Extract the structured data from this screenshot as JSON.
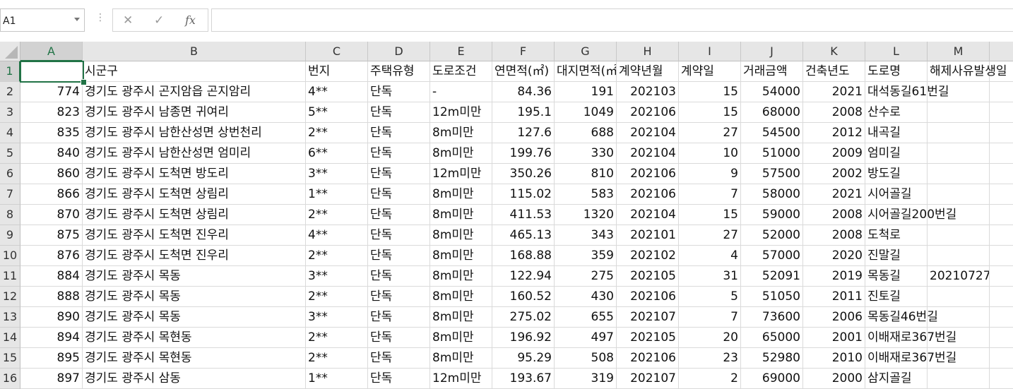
{
  "name_box": {
    "value": "A1"
  },
  "formula_bar": {
    "value": "",
    "cancel_glyph": "✕",
    "enter_glyph": "✓",
    "fx_label": "fx"
  },
  "columns": [
    "A",
    "B",
    "C",
    "D",
    "E",
    "F",
    "G",
    "H",
    "I",
    "J",
    "K",
    "L",
    "M"
  ],
  "rows": [
    {
      "num": "1",
      "cells": [
        "",
        "시군구",
        "번지",
        "주택유형",
        "도로조건",
        "연면적(㎡)",
        "대지면적(㎡)",
        "계약년월",
        "계약일",
        "거래금액",
        "건축년도",
        "도로명",
        "해제사유발생일"
      ]
    },
    {
      "num": "2",
      "cells": [
        "774",
        "경기도 광주시 곤지암읍 곤지암리",
        "4**",
        "단독",
        "-",
        "84.36",
        "191",
        "202103",
        "15",
        "54000",
        "2021",
        "대석동길61번길",
        ""
      ]
    },
    {
      "num": "3",
      "cells": [
        "823",
        "경기도 광주시 남종면 귀여리",
        "5**",
        "단독",
        "12m미만",
        "195.1",
        "1049",
        "202106",
        "15",
        "68000",
        "2008",
        "산수로",
        ""
      ]
    },
    {
      "num": "4",
      "cells": [
        "835",
        "경기도 광주시 남한산성면 상번천리",
        "2**",
        "단독",
        "8m미만",
        "127.6",
        "688",
        "202104",
        "27",
        "54500",
        "2012",
        "내곡길",
        ""
      ]
    },
    {
      "num": "5",
      "cells": [
        "840",
        "경기도 광주시 남한산성면 엄미리",
        "6**",
        "단독",
        "8m미만",
        "199.76",
        "330",
        "202104",
        "10",
        "51000",
        "2009",
        "엄미길",
        ""
      ]
    },
    {
      "num": "6",
      "cells": [
        "860",
        "경기도 광주시 도척면 방도리",
        "3**",
        "단독",
        "12m미만",
        "350.26",
        "810",
        "202106",
        "9",
        "57500",
        "2002",
        "방도길",
        ""
      ]
    },
    {
      "num": "7",
      "cells": [
        "866",
        "경기도 광주시 도척면 상림리",
        "1**",
        "단독",
        "8m미만",
        "115.02",
        "583",
        "202106",
        "7",
        "58000",
        "2021",
        "시어골길",
        ""
      ]
    },
    {
      "num": "8",
      "cells": [
        "870",
        "경기도 광주시 도척면 상림리",
        "2**",
        "단독",
        "8m미만",
        "411.53",
        "1320",
        "202104",
        "15",
        "59000",
        "2008",
        "시어골길200번길",
        ""
      ]
    },
    {
      "num": "9",
      "cells": [
        "875",
        "경기도 광주시 도척면 진우리",
        "4**",
        "단독",
        "8m미만",
        "465.13",
        "343",
        "202101",
        "27",
        "52000",
        "2008",
        "도척로",
        ""
      ]
    },
    {
      "num": "10",
      "cells": [
        "876",
        "경기도 광주시 도척면 진우리",
        "2**",
        "단독",
        "8m미만",
        "168.88",
        "359",
        "202102",
        "4",
        "57000",
        "2020",
        "진말길",
        ""
      ]
    },
    {
      "num": "11",
      "cells": [
        "884",
        "경기도 광주시 목동",
        "3**",
        "단독",
        "8m미만",
        "122.94",
        "275",
        "202105",
        "31",
        "52091",
        "2019",
        "목동길",
        "20210727"
      ]
    },
    {
      "num": "12",
      "cells": [
        "888",
        "경기도 광주시 목동",
        "2**",
        "단독",
        "8m미만",
        "160.52",
        "430",
        "202106",
        "5",
        "51050",
        "2011",
        "진토길",
        ""
      ]
    },
    {
      "num": "13",
      "cells": [
        "890",
        "경기도 광주시 목동",
        "3**",
        "단독",
        "8m미만",
        "275.02",
        "655",
        "202107",
        "7",
        "73600",
        "2006",
        "목동길46번길",
        ""
      ]
    },
    {
      "num": "14",
      "cells": [
        "894",
        "경기도 광주시 목현동",
        "2**",
        "단독",
        "8m미만",
        "196.92",
        "497",
        "202105",
        "20",
        "65000",
        "2001",
        "이배재로367번길",
        ""
      ]
    },
    {
      "num": "15",
      "cells": [
        "895",
        "경기도 광주시 목현동",
        "2**",
        "단독",
        "8m미만",
        "95.29",
        "508",
        "202106",
        "23",
        "52980",
        "2010",
        "이배재로367번길",
        ""
      ]
    },
    {
      "num": "16",
      "cells": [
        "897",
        "경기도 광주시 삼동",
        "1**",
        "단독",
        "12m미만",
        "193.67",
        "319",
        "202107",
        "2",
        "69000",
        "2000",
        "삼지골길",
        ""
      ]
    }
  ]
}
